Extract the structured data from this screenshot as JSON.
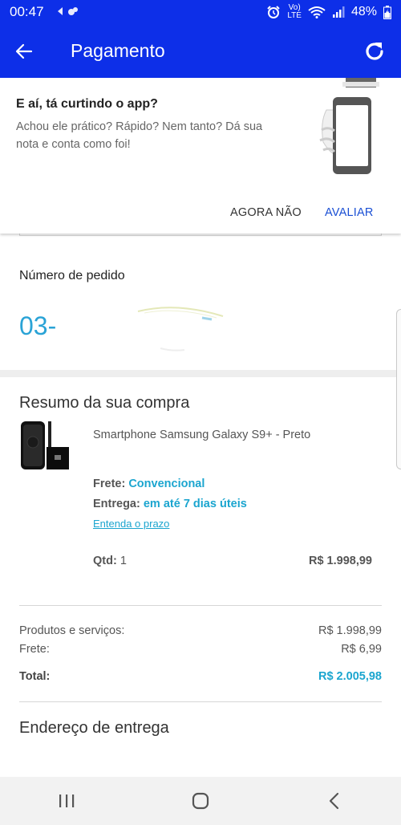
{
  "status_bar": {
    "time": "00:47",
    "network_top": "Vo)",
    "network_bottom": "LTE",
    "battery": "48%"
  },
  "app_bar": {
    "title": "Pagamento",
    "color": "#0d2fe8"
  },
  "rating_prompt": {
    "title": "E aí, tá curtindo o app?",
    "text": "Achou ele prático? Rápido? Nem tanto? Dá sua nota e conta como foi!",
    "dismiss_label": "AGORA NÃO",
    "rate_label": "AVALIAR"
  },
  "order": {
    "label": "Número de pedido",
    "number_visible": "03-"
  },
  "summary": {
    "title": "Resumo da sua compra",
    "product_name": "Smartphone Samsung Galaxy S9+ - Preto",
    "shipping_label": "Frete:",
    "shipping_value": "Convencional",
    "delivery_label": "Entrega:",
    "delivery_value": "em até 7 dias úteis",
    "term_link": "Entenda o prazo",
    "qty_label": "Qtd:",
    "qty_value": "1",
    "price": "R$ 1.998,99"
  },
  "totals": {
    "products_label": "Produtos e serviços:",
    "products_value": "R$ 1.998,99",
    "shipping_label": "Frete:",
    "shipping_value": "R$ 6,99",
    "total_label": "Total:",
    "total_value": "R$ 2.005,98",
    "accent_color": "#1ba5cf"
  },
  "address": {
    "title": "Endereço de entrega"
  },
  "nav_bar": {
    "recents_icon": "recents-icon",
    "home_icon": "home-icon",
    "back_icon": "back-icon"
  }
}
